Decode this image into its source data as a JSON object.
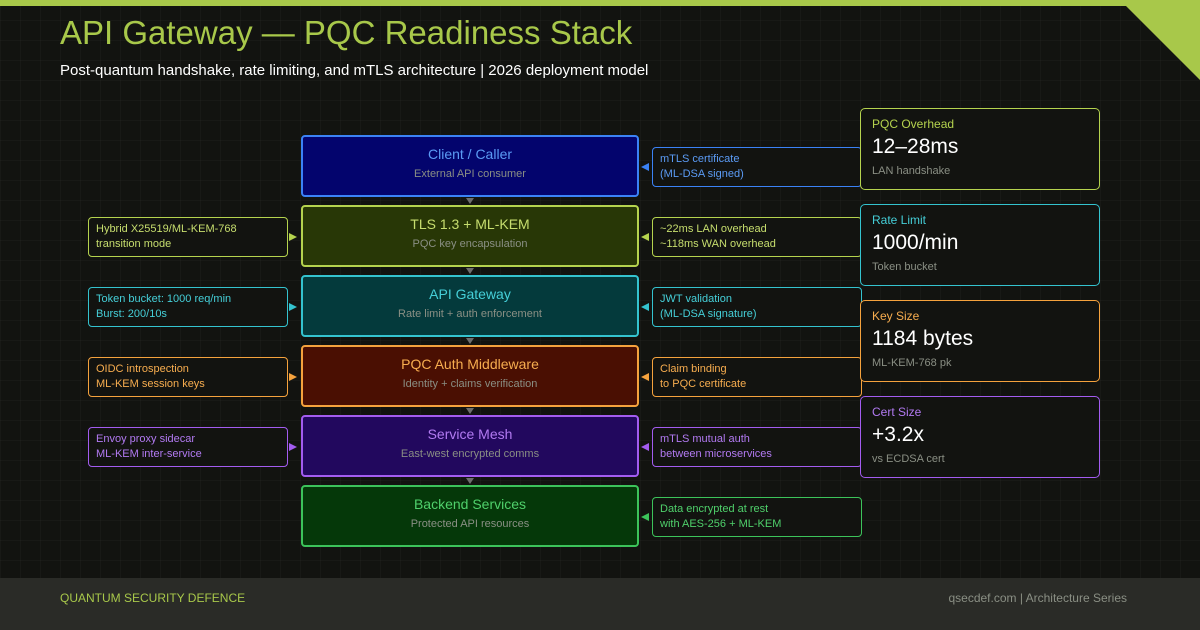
{
  "header": {
    "title": "API Gateway — PQC Readiness Stack",
    "subtitle": "Post-quantum handshake, rate limiting, and mTLS architecture  |  2026 deployment model"
  },
  "colors": {
    "accent": "#a8c84a",
    "blue": "#3b82f6",
    "lime": "#b5d34e",
    "cyan": "#34c3cf",
    "orange": "#f5a23d",
    "purple": "#a35cf0",
    "green": "#3cc35a"
  },
  "layers": [
    {
      "name": "Client / Caller",
      "desc": "External API consumer"
    },
    {
      "name": "TLS 1.3 + ML-KEM",
      "desc": "PQC key encapsulation"
    },
    {
      "name": "API Gateway",
      "desc": "Rate limit + auth enforcement"
    },
    {
      "name": "PQC Auth Middleware",
      "desc": "Identity + claims verification"
    },
    {
      "name": "Service Mesh",
      "desc": "East-west encrypted comms"
    },
    {
      "name": "Backend Services",
      "desc": "Protected API resources"
    }
  ],
  "left_notes": [
    {
      "line1": "Hybrid X25519/ML-KEM-768",
      "line2": "transition mode"
    },
    {
      "line1": "Token bucket: 1000 req/min",
      "line2": "Burst: 200/10s"
    },
    {
      "line1": "OIDC introspection",
      "line2": "ML-KEM session keys"
    },
    {
      "line1": "Envoy proxy sidecar",
      "line2": "ML-KEM inter-service"
    }
  ],
  "right_notes": [
    {
      "line1": "mTLS certificate",
      "line2": "(ML-DSA signed)"
    },
    {
      "line1": "~22ms LAN overhead",
      "line2": "~118ms WAN overhead"
    },
    {
      "line1": "JWT validation",
      "line2": "(ML-DSA signature)"
    },
    {
      "line1": "Claim binding",
      "line2": "to PQC certificate"
    },
    {
      "line1": "mTLS mutual auth",
      "line2": "between microservices"
    },
    {
      "line1": "Data encrypted at rest",
      "line2": "with AES-256 + ML-KEM"
    }
  ],
  "metrics": [
    {
      "label": "PQC Overhead",
      "value": "12–28ms",
      "note": "LAN handshake"
    },
    {
      "label": "Rate Limit",
      "value": "1000/min",
      "note": "Token bucket"
    },
    {
      "label": "Key Size",
      "value": "1184 bytes",
      "note": "ML-KEM-768 pk"
    },
    {
      "label": "Cert Size",
      "value": "+3.2x",
      "note": "vs ECDSA cert"
    }
  ],
  "footer": {
    "brand": "QUANTUM SECURITY DEFENCE",
    "credit": "qsecdef.com  |  Architecture Series"
  }
}
